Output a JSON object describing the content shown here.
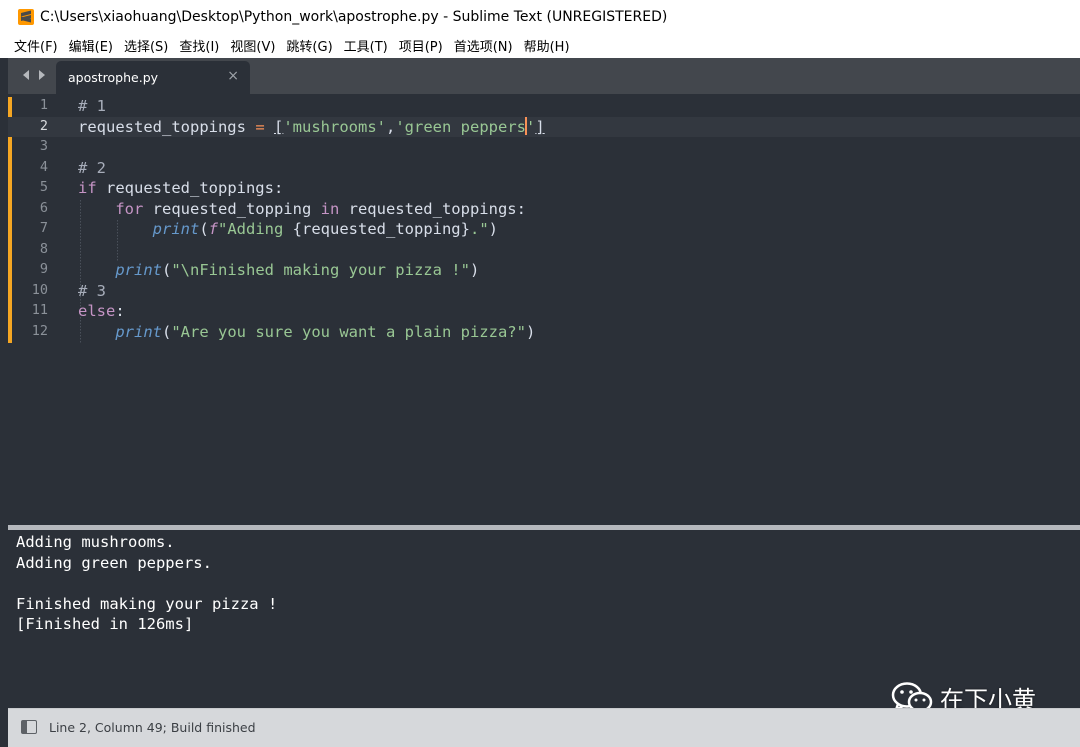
{
  "window": {
    "title": "C:\\Users\\xiaohuang\\Desktop\\Python_work\\apostrophe.py - Sublime Text (UNREGISTERED)"
  },
  "menu": {
    "items": [
      "文件(F)",
      "编辑(E)",
      "选择(S)",
      "查找(I)",
      "视图(V)",
      "跳转(G)",
      "工具(T)",
      "项目(P)",
      "首选项(N)",
      "帮助(H)"
    ]
  },
  "tabs": {
    "active_label": "apostrophe.py",
    "close_glyph": "×"
  },
  "editor": {
    "line_numbers": [
      "1",
      "2",
      "3",
      "4",
      "5",
      "6",
      "7",
      "8",
      "9",
      "10",
      "11",
      "12"
    ],
    "active_line": 2
  },
  "code": {
    "l1_comment": "# 1",
    "l2_var": "requested_toppings ",
    "l2_eq": "=",
    "l2_open": "[",
    "l2_s1": "'mushrooms'",
    "l2_comma": ",",
    "l2_s2a": "'green peppers",
    "l2_s2b": "'",
    "l2_close": "]",
    "l4_comment": "# 2",
    "l5_kw": "if",
    "l5_rest": " requested_toppings:",
    "l6_kw_for": "for",
    "l6_mid": " requested_topping ",
    "l6_kw_in": "in",
    "l6_rest": " requested_toppings:",
    "l7_fn": "print",
    "l7_open": "(",
    "l7_prefix": "f",
    "l7_str1": "\"Adding ",
    "l7_interp": "{requested_topping}",
    "l7_str2": ".\"",
    "l7_close": ")",
    "l9_fn": "print",
    "l9_open": "(",
    "l9_str": "\"\\nFinished making your pizza !\"",
    "l9_close": ")",
    "l10_comment": "# 3",
    "l11_kw": "else",
    "l11_colon": ":",
    "l12_fn": "print",
    "l12_open": "(",
    "l12_str": "\"Are you sure you want a plain pizza?\"",
    "l12_close": ")"
  },
  "output": {
    "lines": [
      "Adding mushrooms.",
      "Adding green peppers.",
      "",
      "Finished making your pizza !",
      "[Finished in 126ms]"
    ]
  },
  "status": {
    "text": "Line 2, Column 49; Build finished"
  },
  "watermark": {
    "text": "在下小黄",
    "icon": "wechat-icon"
  },
  "icons": {
    "app": "sublime-text-icon",
    "nav_back": "chevron-left-icon",
    "nav_forward": "chevron-right-icon",
    "panel": "panel-toggle-icon"
  },
  "colors": {
    "editor_bg": "#2b3038",
    "gutter_marker": "#f5a623",
    "keyword": "#c594c5",
    "function": "#6699cc",
    "string": "#99c794",
    "operator": "#f99157",
    "comment": "#a7adba"
  }
}
